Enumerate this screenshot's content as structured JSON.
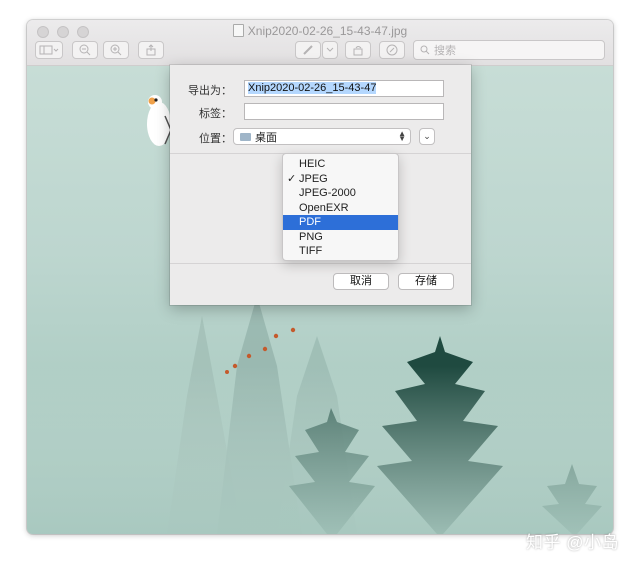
{
  "window": {
    "title": "Xnip2020-02-26_15-43-47.jpg",
    "search_placeholder": "搜索"
  },
  "export_sheet": {
    "export_as_label": "导出为：",
    "export_as_value": "Xnip2020-02-26_15-43-47",
    "tags_label": "标签：",
    "tags_value": "",
    "location_label": "位置：",
    "location_value": "桌面",
    "format_menu": {
      "items": [
        "HEIC",
        "JPEG",
        "JPEG-2000",
        "OpenEXR",
        "PDF",
        "PNG",
        "TIFF"
      ],
      "checked": "JPEG",
      "highlighted": "PDF"
    },
    "cancel_label": "取消",
    "save_label": "存储"
  },
  "watermark": "知乎 @小岛",
  "colors": {
    "menu_highlight": "#2d6fd8",
    "selection": "#b4d7fe",
    "scene_sky": "#c7ddd6",
    "tree_dark": "#1f4a40"
  }
}
